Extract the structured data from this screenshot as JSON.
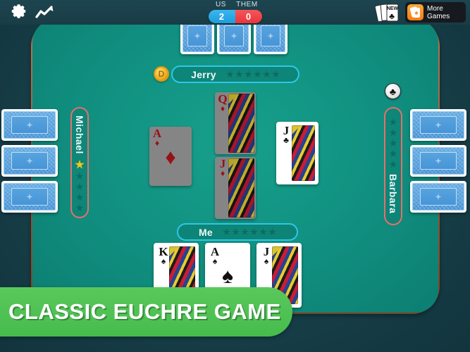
{
  "topbar": {
    "gear_icon": "gear-icon",
    "stats_icon": "trending-up-icon",
    "label_us": "US",
    "label_them": "THEM",
    "score_us": "2",
    "score_them": "0",
    "new_deck_label": "NEW",
    "more_games_line1": "More",
    "more_games_line2": "Games",
    "color_us": "#1e9ddb",
    "color_them": "#e8353c"
  },
  "table": {
    "felt_color": "#119181",
    "rail_color": "#a65a2c",
    "background_color": "#17414a"
  },
  "players": {
    "top": {
      "name": "Jerry",
      "dealer_badge": "D",
      "stars_total": 6,
      "stars_filled": 0,
      "cards_count": 3
    },
    "left": {
      "name": "Michael",
      "stars_total": 6,
      "stars_filled": 1,
      "cards_count": 3
    },
    "right": {
      "name": "Barbara",
      "suit_badge": "♣",
      "stars_total": 6,
      "stars_filled": 0,
      "cards_count": 3
    },
    "bottom": {
      "name": "Me",
      "stars_total": 6,
      "stars_filled": 0,
      "cards_count": 3
    }
  },
  "trick": [
    {
      "rank": "A",
      "suit": "♦",
      "color": "red",
      "state": "dimmed",
      "art": false
    },
    {
      "rank": "Q",
      "suit": "♦",
      "color": "red",
      "state": "dimmed",
      "art": true
    },
    {
      "rank": "J",
      "suit": "♦",
      "color": "red",
      "state": "dimmed",
      "art": true
    },
    {
      "rank": "J",
      "suit": "♣",
      "color": "black",
      "state": "active",
      "art": true
    }
  ],
  "hand": [
    {
      "rank": "K",
      "suit": "♠",
      "color": "black",
      "art": true
    },
    {
      "rank": "A",
      "suit": "♠",
      "color": "black",
      "art": false
    },
    {
      "rank": "J",
      "suit": "♠",
      "color": "black",
      "art": true
    }
  ],
  "banner": {
    "text": "CLASSIC EUCHRE GAME",
    "color": "#46bc4d"
  }
}
